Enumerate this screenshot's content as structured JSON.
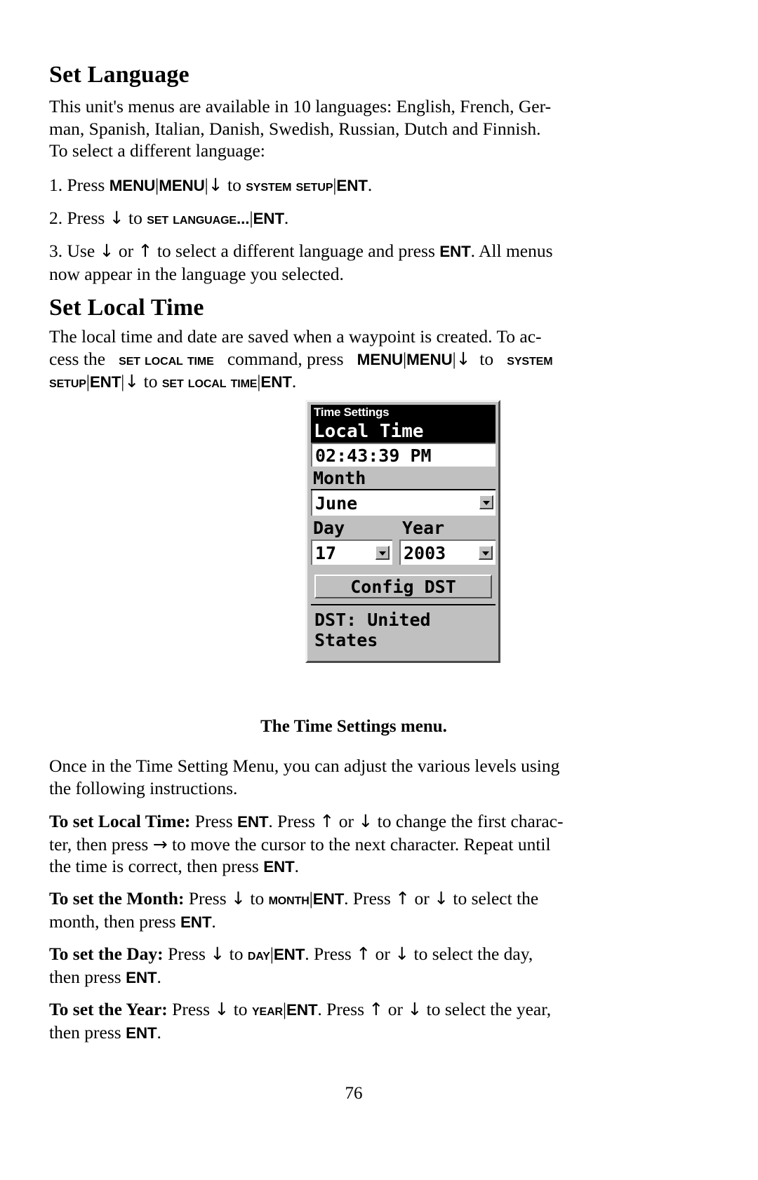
{
  "page": {
    "number": "76"
  },
  "sections": [
    {
      "heading": "Set Language",
      "intro": "This unit's menus are available in 10 languages: English, French, German, Spanish, Italian, Danish, Swedish, Russian, Dutch and Finnish. To select a different language:",
      "steps": [
        {
          "num": "1. Press ",
          "keys": [
            "MENU",
            "MENU"
          ],
          "menu": "System Setup",
          "enter": "ENT"
        },
        {
          "num": "2. Press ",
          "menu": "Set Language...",
          "enter": "ENT"
        },
        {
          "num": "3. Use ",
          "enter": "ENT"
        }
      ]
    },
    {
      "heading": "Set Local Time"
    }
  ],
  "text": {
    "lang_intro_l1": "This unit's menus are available in 10 languages: English, French, Ger-",
    "lang_intro_l2": "man, Spanish, Italian, Danish, Swedish, Russian, Dutch and Finnish.",
    "lang_intro_l3": "To select a different language:",
    "step1_num": "1. Press",
    "step1_key1": "MENU",
    "step1_key2": "MENU",
    "step1_to": "to",
    "step1_menu": "System Setup",
    "step1_ent": "ENT",
    "step1_period": ".",
    "step2_num": "2. Press",
    "step2_to": "to",
    "step2_menu": "Set Language...",
    "step2_ent": "ENT",
    "step2_period": ".",
    "step3_a": "3. Use",
    "step3_b": "or",
    "step3_c": "to select a different language and press",
    "step3_ent": "ENT",
    "step3_d": ". All menus",
    "step3_e": "now appear in the language you selected.",
    "lt_l1": "The local time and date are saved when a waypoint is created. To ac-",
    "lt_l2a": "cess the",
    "lt_l2_menu": "Set Local Time",
    "lt_l2b": "command, press",
    "lt_l2_k1": "MENU",
    "lt_l2_k2": "MENU",
    "lt_l2c": "to",
    "lt_l2_menu2": "System",
    "lt_l3_menu": "Setup",
    "lt_l3_ent": "ENT",
    "lt_l3a": "to",
    "lt_l3_menu2": "Set Local Time",
    "lt_l3_ent2": "ENT",
    "lt_l3_period": ".",
    "caption": "The Time Settings menu.",
    "once_l1": "Once in the Time Setting Menu, you can adjust the various levels using",
    "once_l2": "the following instructions.",
    "slt_lead": "To set Local Time:",
    "slt_a": "Press",
    "slt_ent1": "ENT",
    "slt_b": ". Press",
    "slt_c": "or",
    "slt_d": "to change the first charac-",
    "slt_e": "ter, then press",
    "slt_f": "to move the cursor to the next character. Repeat until",
    "slt_g": "the time is correct, then press",
    "slt_ent2": "ENT",
    "slt_period": ".",
    "month_lead": "To set the Month:",
    "month_a": "Press",
    "month_b": "to",
    "month_menu": "Month",
    "month_ent": "ENT",
    "month_c": ". Press",
    "month_d": "or",
    "month_e": "to select the",
    "month_f": "month, then press",
    "month_ent2": "ENT",
    "month_period": ".",
    "day_lead": "To set the Day:",
    "day_a": "Press",
    "day_b": "to",
    "day_menu": "Day",
    "day_ent": "ENT",
    "day_c": ". Press",
    "day_d": "or",
    "day_e": "to select the day,",
    "day_f": "then press",
    "day_ent2": "ENT",
    "day_period": ".",
    "year_lead": "To set the Year:",
    "year_a": "Press",
    "year_b": "to",
    "year_menu": "Year",
    "year_ent": "ENT",
    "year_c": ". Press",
    "year_d": "or",
    "year_e": "to select the year,",
    "year_f": "then press",
    "year_ent2": "ENT",
    "year_period": "."
  },
  "device_screen": {
    "title": "Time Settings",
    "selected_label": "Local Time",
    "time_value": "02:43:39  PM",
    "month_label": "Month",
    "month_value": "June",
    "day_label": "Day",
    "day_value": "17",
    "year_label": "Year",
    "year_value": "2003",
    "config_button": "Config DST",
    "dst_status": "DST: United States",
    "colors": {
      "panel_bg": "#c0c0c0",
      "field_bg": "#ffffff",
      "highlight_bg": "#000000",
      "highlight_fg": "#ffffff"
    }
  },
  "glyphs": {
    "down": "↓",
    "up": "↑",
    "right": "→",
    "pipe": "|"
  }
}
